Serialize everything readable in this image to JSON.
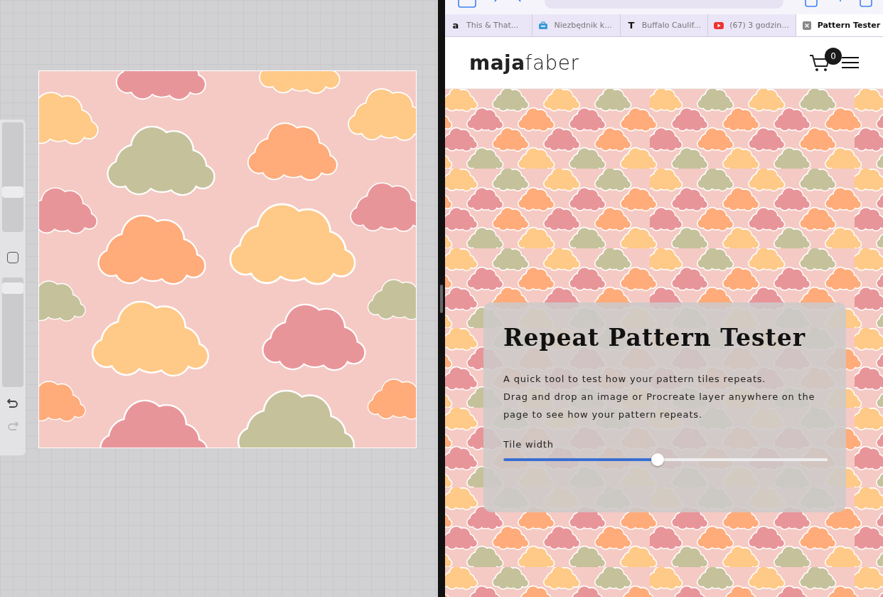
{
  "procreate_sidebar": {
    "brush_size": {
      "level": 0.35
    },
    "opacity": {
      "level": 0.95
    },
    "undo": {
      "disabled": false
    },
    "redo": {
      "disabled": true
    }
  },
  "browser": {
    "tabs": [
      {
        "label": "This & That...",
        "selected": false,
        "icon": {
          "kind": "letter",
          "glyph": "a"
        }
      },
      {
        "label": "Niezbędnik k...",
        "selected": false,
        "icon": {
          "kind": "briefcase"
        }
      },
      {
        "label": "Buffalo Caulif...",
        "selected": false,
        "icon": {
          "kind": "letter",
          "glyph": "T"
        }
      },
      {
        "label": "(67) 3 godzin...",
        "selected": false,
        "icon": {
          "kind": "play"
        }
      },
      {
        "label": "Pattern Tester",
        "selected": true,
        "icon": {
          "kind": "close"
        }
      }
    ]
  },
  "site": {
    "logo": "**maja**faber",
    "cart_count": "0",
    "panel": {
      "title": "Repeat Pattern Tester",
      "description": [
        "A quick tool to test how your pattern tiles repeats.",
        "Drag and drop an image or Procreate layer anywhere on the page to see how your pattern repeats."
      ],
      "slider": {
        "label": "Tile width",
        "level": 0.475
      }
    }
  }
}
